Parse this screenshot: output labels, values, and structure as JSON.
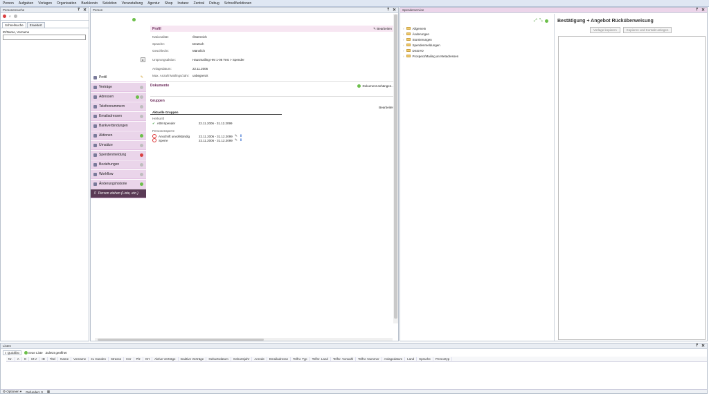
{
  "menu": [
    "Person",
    "Aufgaben",
    "Vorlagen",
    "Organisation",
    "Bankkonto",
    "Selektion",
    "Veranstaltung",
    "Agentur",
    "Shop",
    "Instanz",
    "Zentral",
    "Debug",
    "Schnellfunktionen"
  ],
  "left_panel": {
    "title": "Personensuche",
    "tabs": [
      "Schnellsuche",
      "Erweitert"
    ],
    "search_label": "ID/Name, Vorname",
    "search_value": ""
  },
  "person_panel": {
    "title": "Person",
    "nav": [
      {
        "label": "Profil",
        "status": "edit"
      },
      {
        "label": "Verträge",
        "status": "gray"
      },
      {
        "label": "Adressen",
        "status": "green-gray"
      },
      {
        "label": "Telefonnummern",
        "status": "gray"
      },
      {
        "label": "Emailadressen",
        "status": "gray"
      },
      {
        "label": "Bankverbindungen",
        "status": "none"
      },
      {
        "label": "Aktionen",
        "status": "green"
      },
      {
        "label": "Umsätze",
        "status": "gray"
      },
      {
        "label": "Spendenmeldung",
        "status": "red"
      },
      {
        "label": "Beziehungen",
        "status": "gray"
      },
      {
        "label": "Workflow",
        "status": "gray"
      },
      {
        "label": "Änderungshistorie",
        "status": "green"
      }
    ],
    "drag_hint": "Person ziehen (Liste, etc.)",
    "profile": {
      "section_title": "Profil",
      "edit_label": "Bearbeiten",
      "fields": [
        {
          "k": "Nationalität:",
          "v": "Österreich"
        },
        {
          "k": "Sprache:",
          "v": "Deutsch"
        },
        {
          "k": "Geschlecht:",
          "v": "Männlich"
        },
        {
          "k": "Ursprungsaktion:",
          "v": "Hausmailing HM 1-06 Test > Spender"
        },
        {
          "k": "Anlagedatum:",
          "v": "22.11.2006"
        },
        {
          "k": "Max. Anzahl Mailings/Jahr:",
          "v": "unbegrenzt"
        }
      ]
    },
    "documents": {
      "title": "Dokumente",
      "attach_label": "Dokument anhängen..."
    },
    "groups": {
      "title": "Gruppen",
      "edit_label": "Bearbeiten",
      "current_title": "Aktuelle Gruppen",
      "herkunft_label": "Herkunft",
      "herkunft": [
        {
          "name": "A08-Spender",
          "range": "22.11.2006 - 31.12.2099"
        }
      ],
      "sperren_label": "Personensperre",
      "sperren": [
        {
          "name": "Anschrift unvollständig",
          "range": "22.11.2006 - 31.12.2099"
        },
        {
          "name": "Sperre",
          "range": "22.11.2006 - 31.12.2099"
        }
      ]
    }
  },
  "spender_panel": {
    "title": "Spenderservice",
    "tree": [
      "Allgemein",
      "Änderungen",
      "Stornierungen",
      "Spendenmeldungen",
      "DSGVO",
      "Prospect/Mailing an Metadressen"
    ],
    "heading": "Bestätigung + Angebot Rücküberweisung",
    "copy_template": "Vorlage kopieren",
    "copy_contact": "Kopieren und Kontakt anlegen"
  },
  "lists_panel": {
    "title": "Listen",
    "tabs": [
      "Quicklist",
      "neue Liste",
      "Zuletzt geöffnet"
    ],
    "columns": [
      "Nr.",
      "A",
      "G",
      "M.V",
      "ID",
      "Titel",
      "Name",
      "Vorname",
      "zu Handen",
      "Strasse",
      "Hnr",
      "Plz",
      "Ort",
      "Aktive Verträge",
      "Inaktive Verträge",
      "Geburtsdatum",
      "Geburtsjahr",
      "Anrede",
      "Emailadresse",
      "Telfnr. Typ",
      "Telfnr. Land",
      "Telfnr. Vorwahl",
      "Telfnr. Nummer",
      "Anlagedatum",
      "Land",
      "Sprache",
      "Persontyp"
    ],
    "footer_options": "Optionen",
    "footer_found": "Gefunden: 0"
  },
  "colors": {
    "accent": "#6b2a5a",
    "nav_bg": "#ead5ea",
    "green": "#6cbf4a",
    "red": "#d94040"
  }
}
